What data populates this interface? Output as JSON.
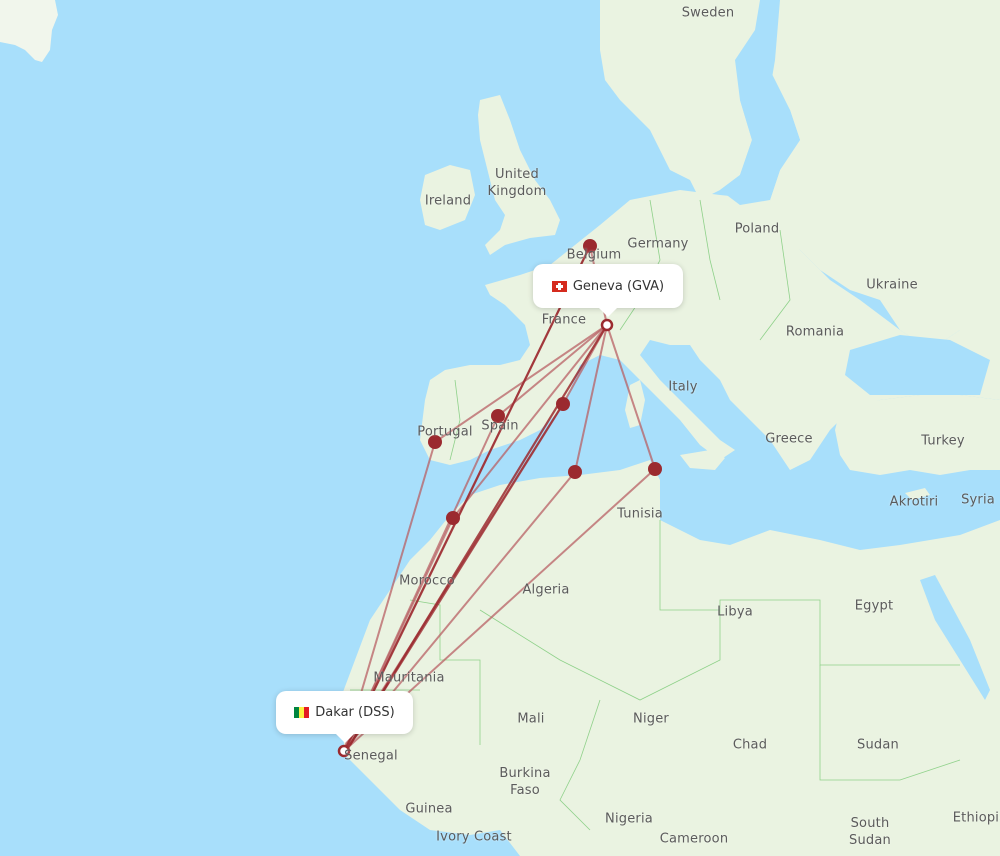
{
  "map": {
    "colors": {
      "water": "#a8dffb",
      "land": "#eaf3e1",
      "land_light": "#f1f6ec",
      "border": "#8fd18a",
      "route": "#9b2a2f",
      "route_faded": "#b86064",
      "marker": "#9b2a2f",
      "label": "#5b5b5b"
    },
    "origin": {
      "name": "Geneva (GVA)",
      "city": "Geneva",
      "code": "GVA",
      "flag": "switzerland-flag-icon"
    },
    "destination": {
      "name": "Dakar (DSS)",
      "city": "Dakar",
      "code": "DSS",
      "flag": "senegal-flag-icon"
    },
    "country_labels": [
      {
        "id": "sweden",
        "text": "Sweden"
      },
      {
        "id": "united-kingdom",
        "text": "United\nKingdom"
      },
      {
        "id": "ireland",
        "text": "Ireland"
      },
      {
        "id": "germany",
        "text": "Germany"
      },
      {
        "id": "poland",
        "text": "Poland"
      },
      {
        "id": "belgium",
        "text": "Belgium"
      },
      {
        "id": "ukraine",
        "text": "Ukraine"
      },
      {
        "id": "france",
        "text": "France"
      },
      {
        "id": "romania",
        "text": "Romania"
      },
      {
        "id": "italy",
        "text": "Italy"
      },
      {
        "id": "portugal",
        "text": "Portugal"
      },
      {
        "id": "spain",
        "text": "Spain"
      },
      {
        "id": "greece",
        "text": "Greece"
      },
      {
        "id": "turkey",
        "text": "Turkey"
      },
      {
        "id": "tunisia",
        "text": "Tunisia"
      },
      {
        "id": "akrotiri",
        "text": "Akrotiri"
      },
      {
        "id": "syria",
        "text": "Syria"
      },
      {
        "id": "morocco",
        "text": "Morocco"
      },
      {
        "id": "algeria",
        "text": "Algeria"
      },
      {
        "id": "libya",
        "text": "Libya"
      },
      {
        "id": "egypt",
        "text": "Egypt"
      },
      {
        "id": "mauritania",
        "text": "Mauritania"
      },
      {
        "id": "mali",
        "text": "Mali"
      },
      {
        "id": "niger",
        "text": "Niger"
      },
      {
        "id": "chad",
        "text": "Chad"
      },
      {
        "id": "sudan",
        "text": "Sudan"
      },
      {
        "id": "senegal",
        "text": "Senegal"
      },
      {
        "id": "burkina-faso",
        "text": "Burkina\nFaso"
      },
      {
        "id": "guinea",
        "text": "Guinea"
      },
      {
        "id": "nigeria",
        "text": "Nigeria"
      },
      {
        "id": "ivory-coast",
        "text": "Ivory Coast"
      },
      {
        "id": "cameroon",
        "text": "Cameroon"
      },
      {
        "id": "south-sudan",
        "text": "South\nSudan"
      },
      {
        "id": "ethiopia",
        "text": "Ethiopia"
      }
    ],
    "stopovers": [
      {
        "id": "brussels",
        "region": "Belgium"
      },
      {
        "id": "lisbon",
        "region": "Portugal"
      },
      {
        "id": "madrid",
        "region": "Spain"
      },
      {
        "id": "barcelona",
        "region": "Spain"
      },
      {
        "id": "casablanca",
        "region": "Morocco"
      },
      {
        "id": "algiers",
        "region": "Algeria"
      },
      {
        "id": "tunis",
        "region": "Tunisia"
      }
    ]
  }
}
